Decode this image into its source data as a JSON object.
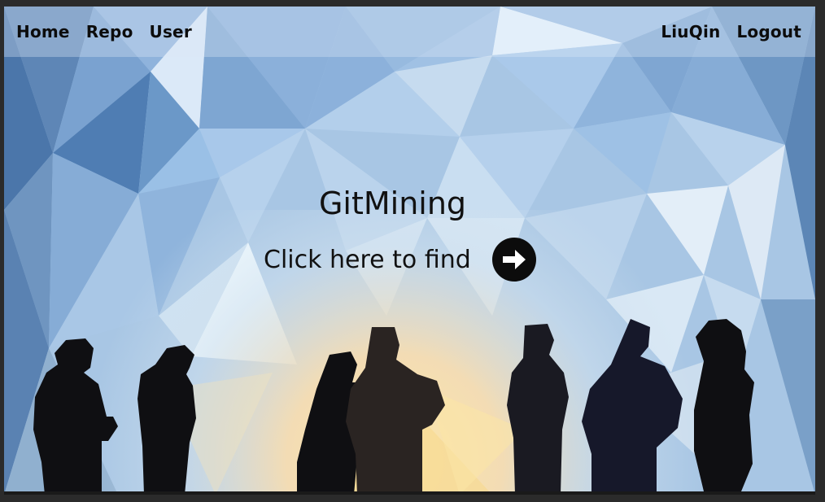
{
  "nav": {
    "left": [
      "Home",
      "Repo",
      "User"
    ],
    "right": [
      "LiuQin",
      "Logout"
    ]
  },
  "hero": {
    "title": "GitMining",
    "cta": "Click here to find",
    "cta_icon": "arrow-right-circle-icon"
  },
  "colors": {
    "sky": "#9fc0e0",
    "text": "#111111",
    "silhouette": "#0f0f12"
  }
}
